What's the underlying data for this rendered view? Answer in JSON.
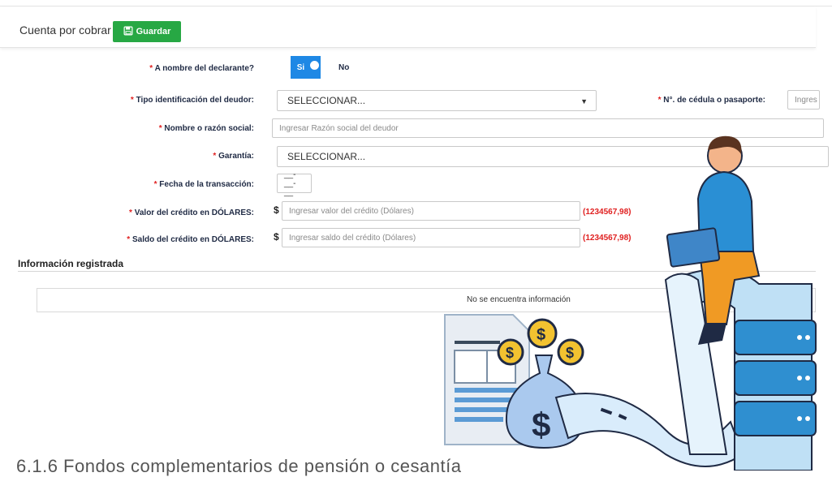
{
  "header": {
    "title": "Cuenta por cobrar",
    "save_label": "Guardar"
  },
  "form": {
    "declarante": {
      "label": "A nombre del declarante?",
      "yes": "Si",
      "no": "No"
    },
    "tipo_id": {
      "label": "Tipo identificación del deudor:",
      "value": "SELECCIONAR..."
    },
    "cedula": {
      "label": "N°. de cédula o pasaporte:",
      "placeholder": "Ingres"
    },
    "nombre": {
      "label": "Nombre o razón social:",
      "placeholder": "Ingresar Razón social del deudor"
    },
    "garantia": {
      "label": "Garantía:",
      "value": "SELECCIONAR..."
    },
    "fecha": {
      "label": "Fecha de la transacción:",
      "value": "__-__-__"
    },
    "valor": {
      "label": "Valor del crédito en DÓLARES:",
      "placeholder": "Ingresar valor del crédito (Dólares)",
      "example": "(1234567,98)"
    },
    "saldo": {
      "label": "Saldo del crédito en DÓLARES:",
      "placeholder": "Ingresar saldo del crédito (Dólares)",
      "example": "(1234567,98)"
    },
    "required_mark": "*",
    "currency": "$"
  },
  "registered": {
    "title": "Información registrada",
    "empty_message": "No se encuentra información"
  },
  "caption": "6.1.6 Fondos complementarios de pensión o cesantía",
  "colors": {
    "accent": "#1e88e5",
    "save": "#27a844",
    "required": "#e02020"
  },
  "icons": {
    "save": "floppy-disk-icon",
    "dropdown": "caret-down-icon",
    "dollar": "dollar-coin-icon"
  }
}
